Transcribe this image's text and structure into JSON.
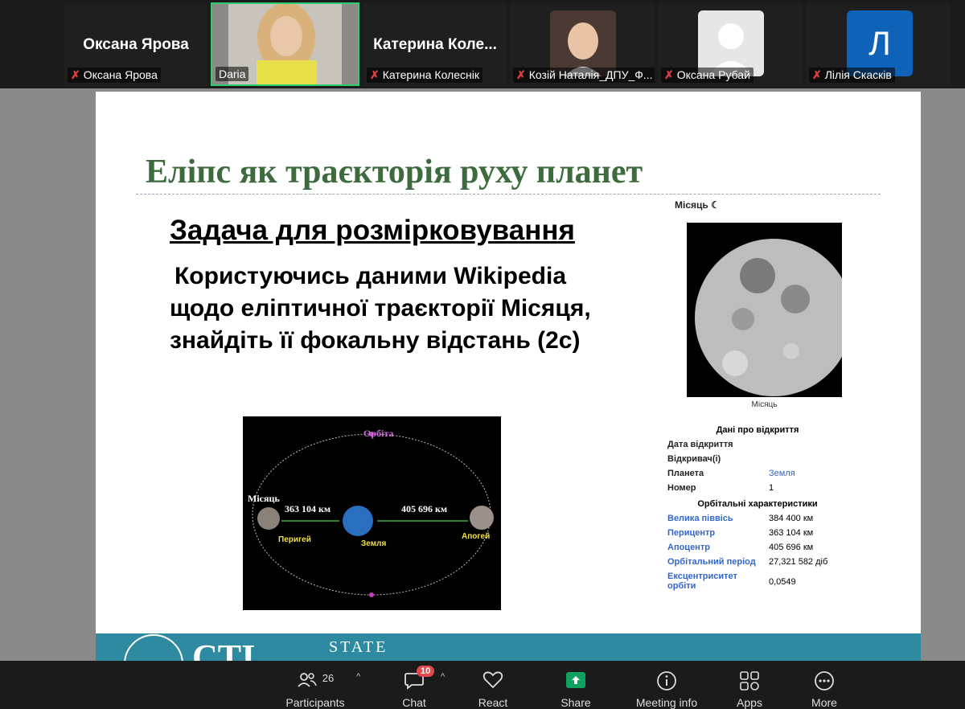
{
  "participants_strip": [
    {
      "big_name": "Оксана Ярова",
      "tag": "Оксана Ярова",
      "muted": true
    },
    {
      "big_name": "",
      "tag": "Daria",
      "muted": false,
      "active_speaker": true
    },
    {
      "big_name": "Катерина  Коле...",
      "tag": "Катерина Колеснік",
      "muted": true
    },
    {
      "big_name": "",
      "tag": "Козій Наталія_ДПУ_Ф...",
      "muted": true
    },
    {
      "big_name": "",
      "tag": "Оксана Рубай",
      "muted": true
    },
    {
      "big_name": "",
      "tag": "Лілія Скасків",
      "muted": true,
      "avatar_letter": "Л"
    }
  ],
  "slide": {
    "title": "Еліпс як траєкторія руху планет",
    "task_heading": "Задача для розмірковування",
    "task_lines": [
      "Користуючись даними Wikipedia",
      "щодо еліптичної траєкторії Місяця,",
      "знайдіть її фокальну відстань (2с)"
    ],
    "orbit_figure": {
      "orbit_label": "Орбіта",
      "moon_label": "Місяць",
      "perigee_distance": "363 104 км",
      "apogee_distance": "405 696 км",
      "perigee_label": "Перигей",
      "earth_label": "Земля",
      "apogee_label": "Апогей"
    },
    "wiki": {
      "header": "Місяць ☾",
      "photo_caption": "Місяць",
      "section_discovery": "Дані про відкриття",
      "section_orbital": "Орбітальні характеристики",
      "rows_discovery": [
        {
          "label": "Дата відкриття",
          "value": ""
        },
        {
          "label": "Відкривач(і)",
          "value": ""
        },
        {
          "label": "Планета",
          "value": "Земля",
          "value_link": true
        },
        {
          "label": "Номер",
          "value": "1"
        }
      ],
      "rows_orbital": [
        {
          "label": "Велика піввісь",
          "value": "384 400 км"
        },
        {
          "label": "Перицентр",
          "value": "363 104 км"
        },
        {
          "label": "Апоцентр",
          "value": "405 696 км"
        },
        {
          "label": "Орбітальний період",
          "value": "27,321 582 діб"
        },
        {
          "label": "Ексцентриситет орбіти",
          "value": "0,0549"
        }
      ]
    },
    "footer_state": "STATE",
    "footer_logo": "СТІ"
  },
  "toolbar": {
    "participants": {
      "label": "Participants",
      "count": "26"
    },
    "chat": {
      "label": "Chat",
      "badge": "10"
    },
    "react": {
      "label": "React"
    },
    "share": {
      "label": "Share"
    },
    "meeting_info": {
      "label": "Meeting info"
    },
    "apps": {
      "label": "Apps"
    },
    "more": {
      "label": "More"
    }
  },
  "colors": {
    "title_green": "#3e6b3e",
    "share_green": "#0fa15d",
    "badge_red": "#e5484d",
    "active_border": "#2ecc71",
    "wiki_link": "#3366cc"
  }
}
